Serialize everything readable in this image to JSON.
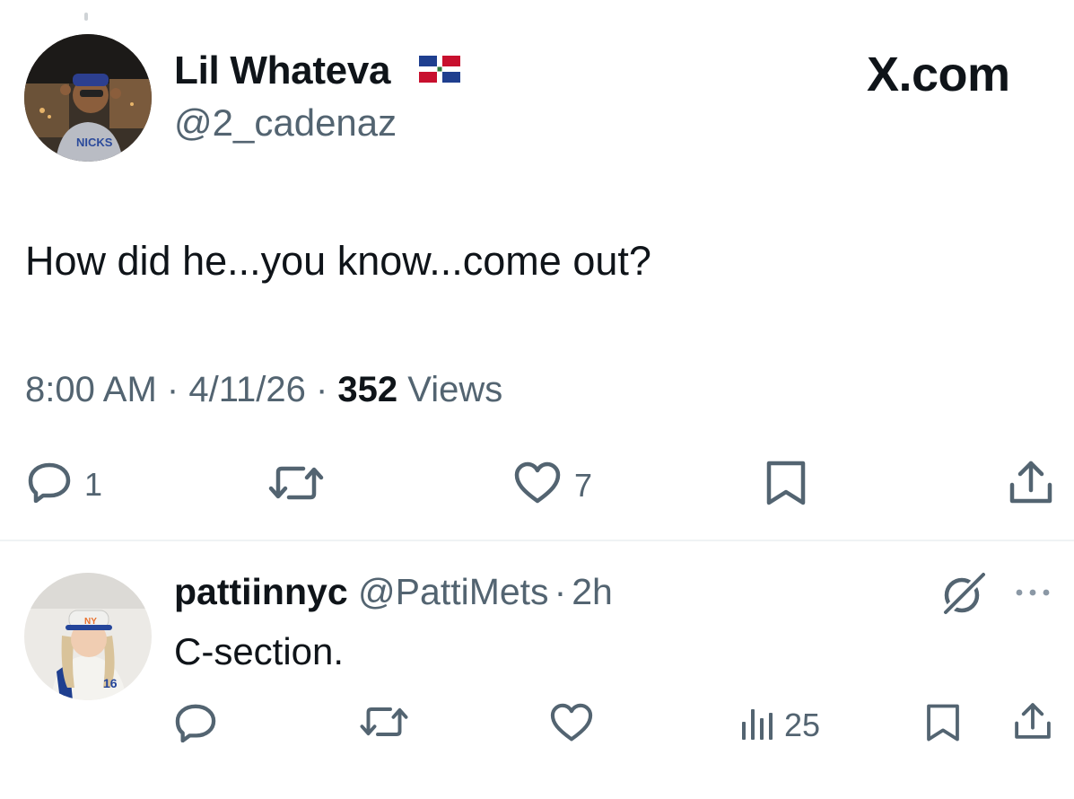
{
  "tweet": {
    "author_name": "Lil Whateva",
    "author_handle": "@2_cadenaz",
    "flag_icon": "dominican-republic-flag-icon",
    "brand": "X.com",
    "text": "How did he...you know...come out?",
    "time": "8:00 AM",
    "separator": "·",
    "date": "4/11/26",
    "views_count": "352",
    "views_label": "Views",
    "actions": {
      "reply_count": "1",
      "like_count": "7"
    }
  },
  "reply": {
    "author_name": "pattiinnyc",
    "author_handle": "@PattiMets",
    "separator": "·",
    "age": "2h",
    "text": "C-section.",
    "actions": {
      "views_count": "25"
    }
  },
  "colors": {
    "text": "#0f1419",
    "secondary": "#536471",
    "divider": "#eff3f4"
  }
}
